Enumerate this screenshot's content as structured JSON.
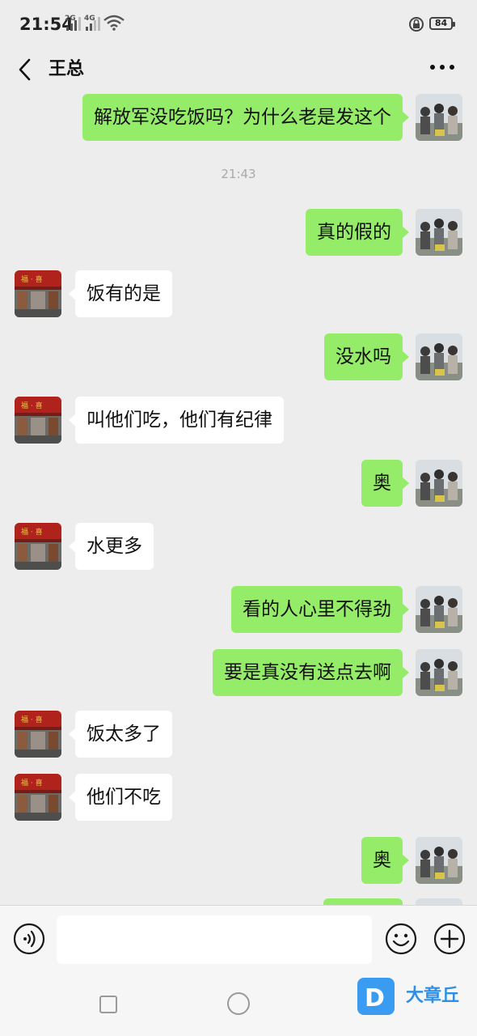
{
  "status_bar": {
    "time": "21:54",
    "network_1": "2G",
    "network_2": "4G",
    "battery": "84"
  },
  "header": {
    "title": "王总"
  },
  "messages": [
    {
      "from": "me",
      "text": "解放军没吃饭吗？为什么老是发这个"
    },
    {
      "type": "time",
      "text": "21:43"
    },
    {
      "from": "me",
      "text": "真的假的"
    },
    {
      "from": "them",
      "text": "饭有的是"
    },
    {
      "from": "me",
      "text": "没水吗"
    },
    {
      "from": "them",
      "text": "叫他们吃，他们有纪律"
    },
    {
      "from": "me",
      "text": "奥"
    },
    {
      "from": "them",
      "text": "水更多"
    },
    {
      "from": "me",
      "text": "看的人心里不得劲"
    },
    {
      "from": "me",
      "text": "要是真没有送点去啊"
    },
    {
      "from": "them",
      "text": "饭太多了"
    },
    {
      "from": "them",
      "text": "他们不吃"
    },
    {
      "from": "me",
      "text": "奥"
    }
  ],
  "input": {
    "value": "",
    "placeholder": ""
  },
  "icons": {
    "back": "chevron-left-icon",
    "more": "more-dots-icon",
    "voice": "voice-icon",
    "emoji": "smiley-icon",
    "plus": "plus-icon"
  },
  "colors": {
    "my_bubble": "#95ec69",
    "their_bubble": "#ffffff",
    "background": "#ededed"
  },
  "watermark": {
    "text": "大章丘"
  }
}
